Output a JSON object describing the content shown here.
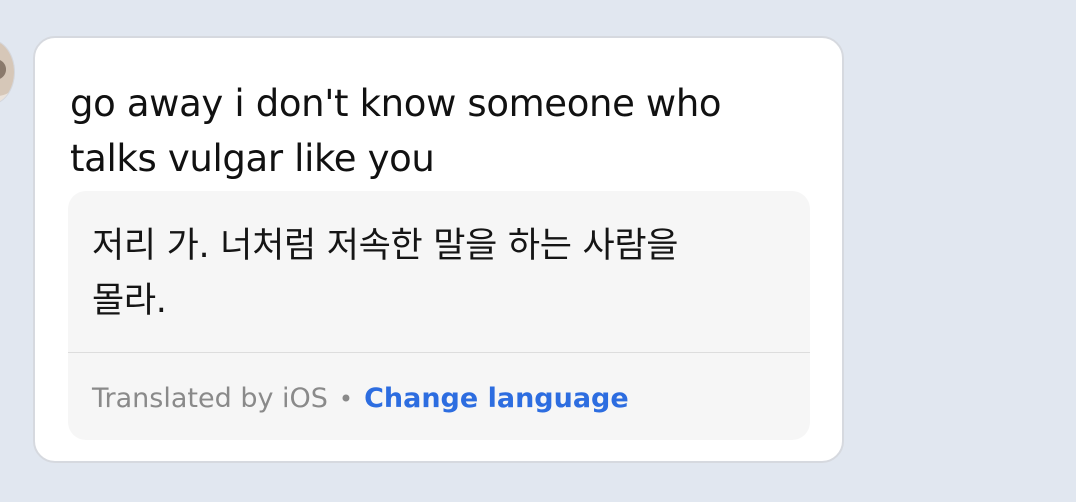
{
  "message": {
    "original_text": "go away i don't know someone who\ntalks vulgar like you"
  },
  "translation": {
    "translated_text": "저리 가. 너처럼 저속한 말을 하는 사람을\n몰라.",
    "source_label": "Translated by iOS",
    "separator": "•",
    "change_language_label": "Change language"
  },
  "colors": {
    "background": "#e1e7f0",
    "bubble": "#ffffff",
    "translation_card": "#f6f6f6",
    "link": "#2d6de0"
  }
}
